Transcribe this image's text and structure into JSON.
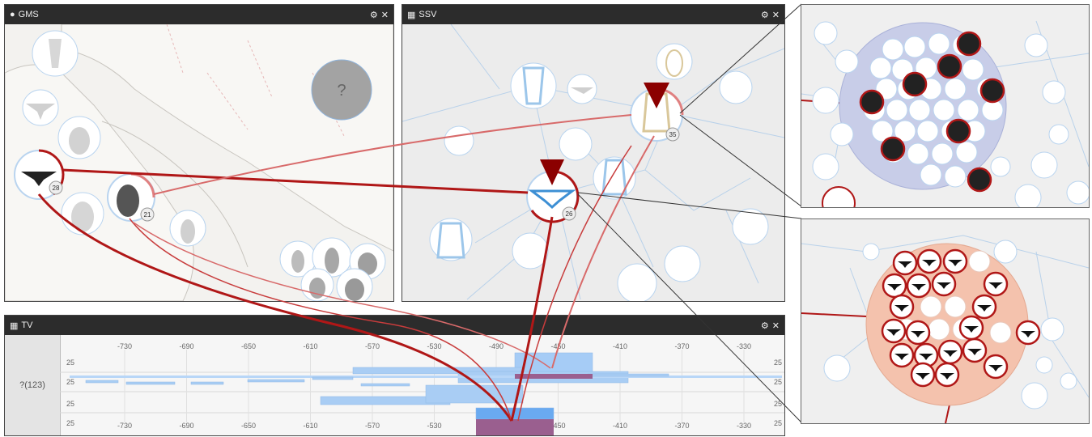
{
  "gms": {
    "title": "GMS",
    "unknown_label": "?",
    "badge_kylix": "28",
    "badge_amphora": "21"
  },
  "ssv": {
    "title": "SSV",
    "badge_hydria": "35",
    "badge_kylix": "26"
  },
  "tv": {
    "title": "TV",
    "row_label": "?(123)",
    "axis_top": [
      "-730",
      "-690",
      "-650",
      "-610",
      "-570",
      "-530",
      "-490",
      "-450",
      "-410",
      "-370",
      "-330"
    ],
    "axis_bottom": [
      "-730",
      "-690",
      "-650",
      "-610",
      "-570",
      "-530",
      "-490",
      "-450",
      "-410",
      "-370",
      "-330"
    ],
    "row_values": [
      "25",
      "25",
      "25",
      "25"
    ]
  },
  "colors": {
    "accent": "#b01717",
    "header": "#2c2c2c",
    "selection_blue": "#c8cde8",
    "selection_orange": "#f4c2ad",
    "timeline_blue": "#8fc2f5",
    "timeline_purple": "#9a5f8f"
  },
  "icons": {
    "gms": "map-marker-icon",
    "ssv": "network-icon",
    "tv": "calendar-icon",
    "settings": "gear-icon",
    "close": "close-icon"
  }
}
